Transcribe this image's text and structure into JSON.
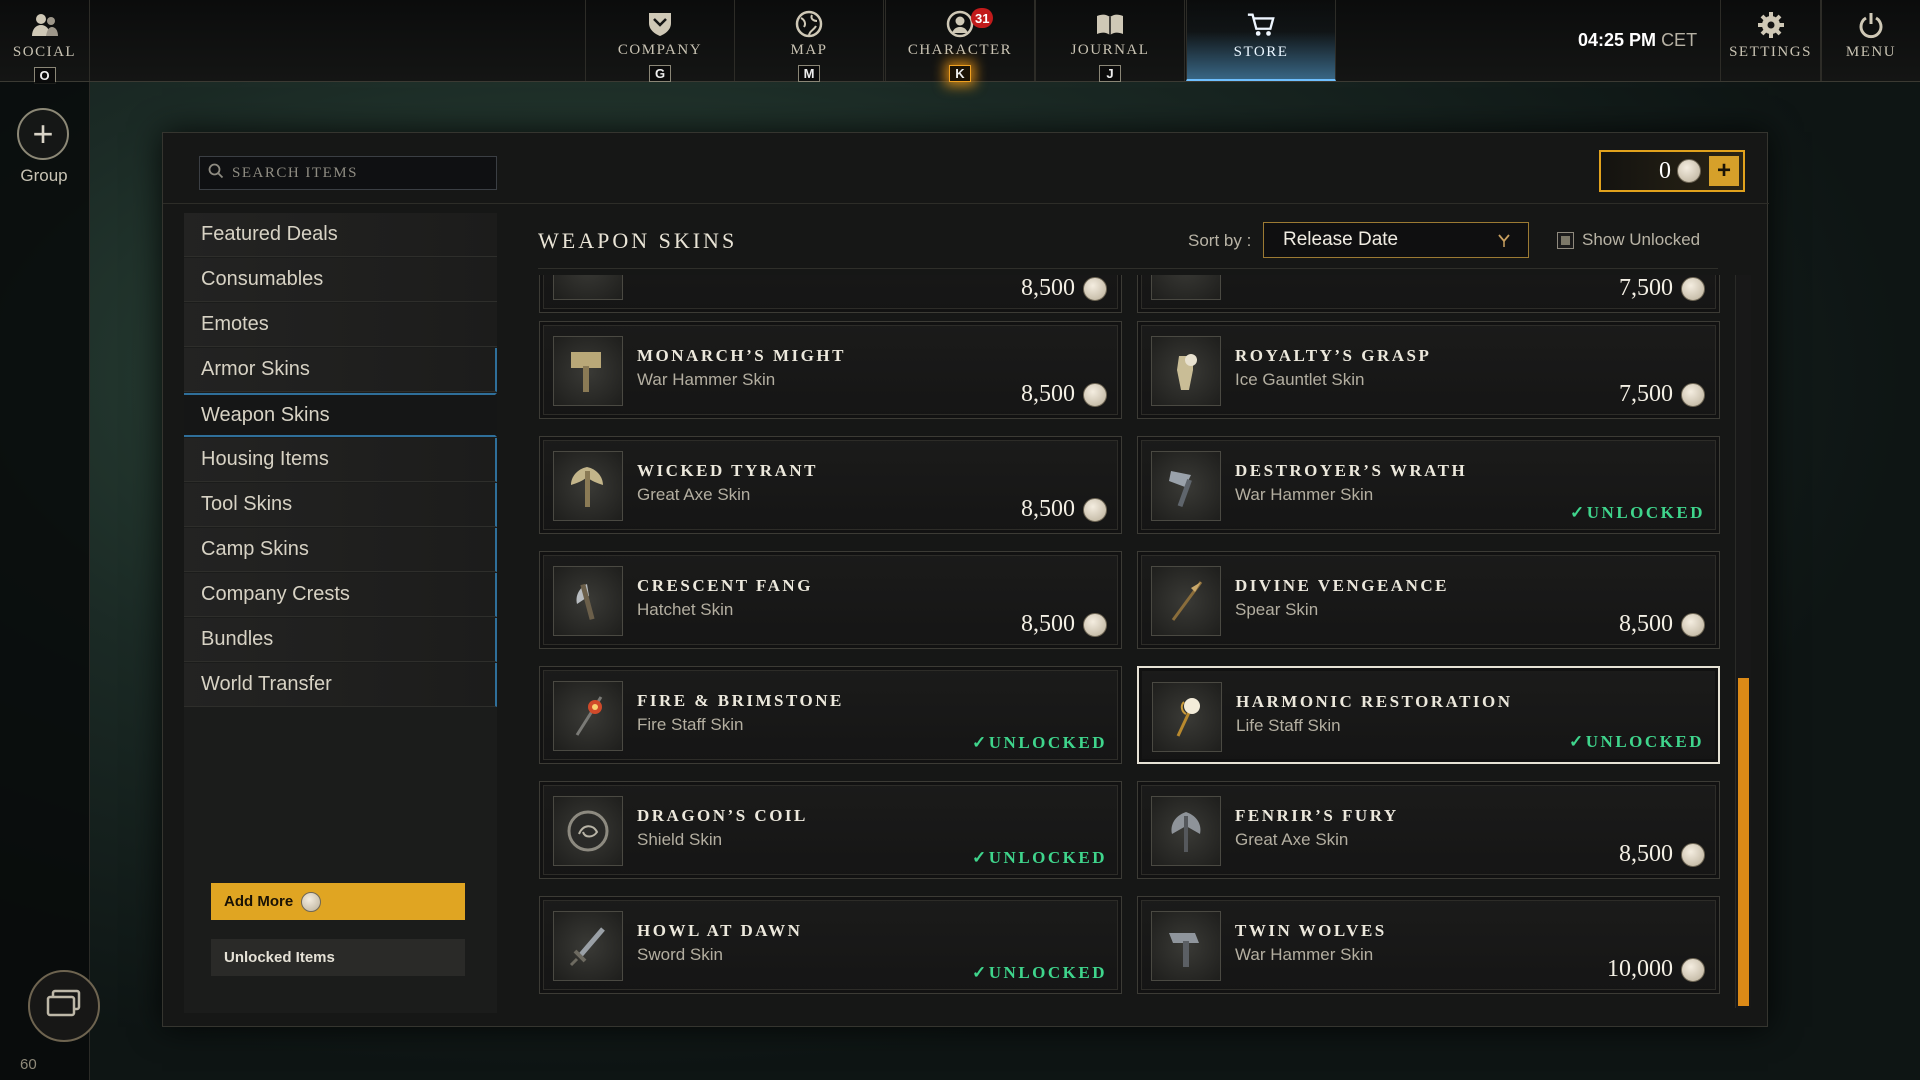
{
  "topbar": {
    "social": {
      "label": "SOCIAL",
      "key": "O"
    },
    "company": {
      "label": "COMPANY",
      "key": "G"
    },
    "map": {
      "label": "MAP",
      "key": "M"
    },
    "character": {
      "label": "CHARACTER",
      "key": "K",
      "badge": "31"
    },
    "journal": {
      "label": "JOURNAL",
      "key": "J"
    },
    "store": {
      "label": "STORE"
    },
    "clock_time": "04:25 PM",
    "clock_zone": "CET",
    "settings": {
      "label": "SETTINGS"
    },
    "menu": {
      "label": "MENU"
    }
  },
  "leftrail": {
    "group_label": "Group",
    "level": "60"
  },
  "store": {
    "search_placeholder": "SEARCH ITEMS",
    "currency_amount": "0",
    "categories": [
      {
        "label": "Featured Deals"
      },
      {
        "label": "Consumables"
      },
      {
        "label": "Emotes"
      },
      {
        "label": "Armor Skins"
      },
      {
        "label": "Weapon Skins"
      },
      {
        "label": "Housing Items"
      },
      {
        "label": "Tool Skins"
      },
      {
        "label": "Camp Skins"
      },
      {
        "label": "Company Crests"
      },
      {
        "label": "Bundles"
      },
      {
        "label": "World Transfer"
      }
    ],
    "add_more_label": "Add More",
    "unlocked_items_label": "Unlocked Items",
    "section_title": "WEAPON SKINS",
    "sort_label": "Sort by :",
    "sort_value": "Release Date",
    "show_unlocked_label": "Show Unlocked",
    "unlocked_text": "UNLOCKED",
    "partial_prices": [
      "8,500",
      "7,500"
    ],
    "items": [
      {
        "name": "MONARCH’S MIGHT",
        "type": "War Hammer Skin",
        "price": "8,500",
        "unlocked": false
      },
      {
        "name": "ROYALTY’S GRASP",
        "type": "Ice Gauntlet Skin",
        "price": "7,500",
        "unlocked": false
      },
      {
        "name": "WICKED TYRANT",
        "type": "Great Axe Skin",
        "price": "8,500",
        "unlocked": false
      },
      {
        "name": "DESTROYER’S WRATH",
        "type": "War Hammer Skin",
        "price": "",
        "unlocked": true
      },
      {
        "name": "CRESCENT FANG",
        "type": "Hatchet Skin",
        "price": "8,500",
        "unlocked": false
      },
      {
        "name": "DIVINE VENGEANCE",
        "type": "Spear Skin",
        "price": "8,500",
        "unlocked": false
      },
      {
        "name": "FIRE & BRIMSTONE",
        "type": "Fire Staff Skin",
        "price": "",
        "unlocked": true
      },
      {
        "name": "HARMONIC RESTORATION",
        "type": "Life Staff Skin",
        "price": "",
        "unlocked": true
      },
      {
        "name": "DRAGON’S COIL",
        "type": "Shield Skin",
        "price": "",
        "unlocked": true
      },
      {
        "name": "FENRIR’S FURY",
        "type": "Great Axe Skin",
        "price": "8,500",
        "unlocked": false
      },
      {
        "name": "HOWL AT DAWN",
        "type": "Sword Skin",
        "price": "",
        "unlocked": true
      },
      {
        "name": "TWIN WOLVES",
        "type": "War Hammer Skin",
        "price": "10,000",
        "unlocked": false
      }
    ]
  },
  "colors": {
    "accent_gold": "#e0a522",
    "unlocked_green": "#3fd58c",
    "active_blue": "#6fc0ff",
    "badge_red": "#c21b1b"
  }
}
